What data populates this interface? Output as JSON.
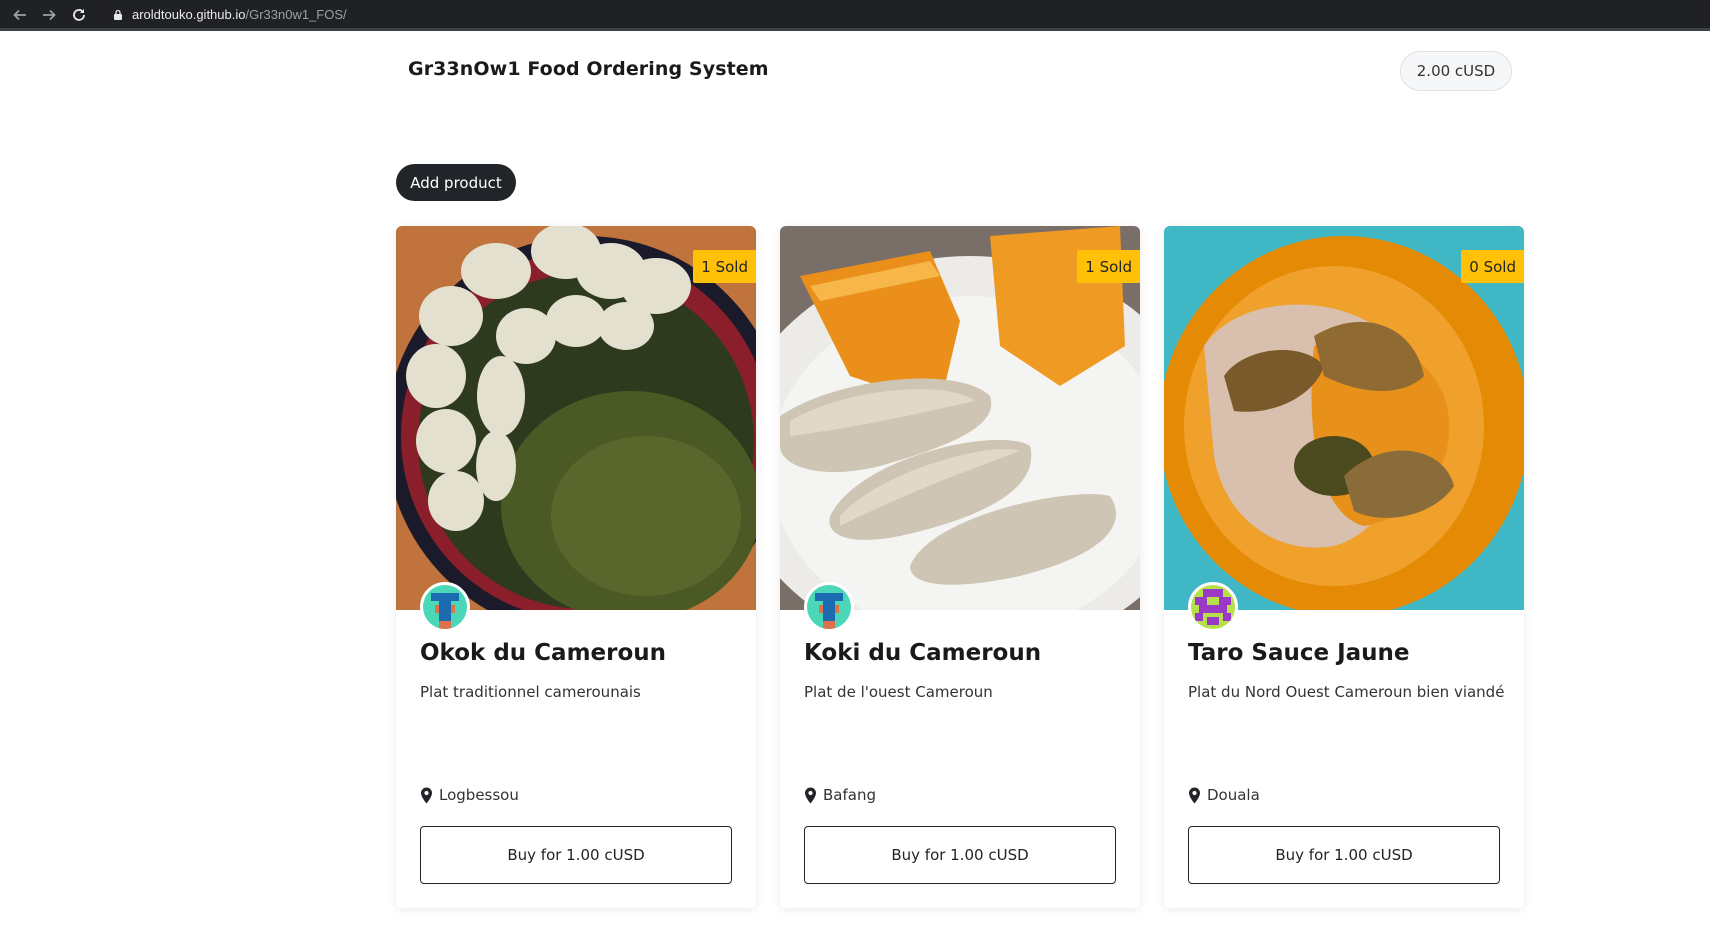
{
  "browser": {
    "url_host": "aroldtouko.github.io",
    "url_path": "/Gr33n0w1_FOS/"
  },
  "header": {
    "title": "Gr33nOw1 Food Ordering System",
    "balance": "2.00 cUSD"
  },
  "actions": {
    "add_product": "Add product"
  },
  "products": [
    {
      "name": "Okok du Cameroun",
      "description": "Plat traditionnel camerounais",
      "location": "Logbessou",
      "sold": "1 Sold",
      "buy_label": "Buy for 1.00 cUSD"
    },
    {
      "name": "Koki du Cameroun",
      "description": "Plat de l'ouest Cameroun",
      "location": "Bafang",
      "sold": "1 Sold",
      "buy_label": "Buy for 1.00 cUSD"
    },
    {
      "name": "Taro Sauce Jaune",
      "description": "Plat du Nord Ouest Cameroun bien viandé",
      "location": "Douala",
      "sold": "0 Sold",
      "buy_label": "Buy for 1.00 cUSD"
    }
  ],
  "colors": {
    "accent_dark": "#212529",
    "badge": "#ffc107",
    "chrome": "#202124"
  },
  "icons": [
    "back-arrow-icon",
    "forward-arrow-icon",
    "reload-icon",
    "lock-icon",
    "map-pin-icon"
  ]
}
